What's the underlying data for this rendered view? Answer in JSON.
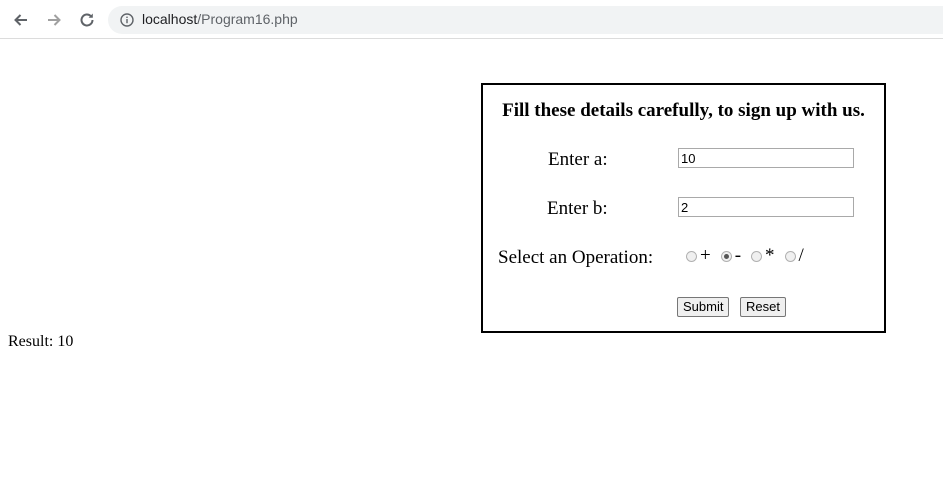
{
  "browser": {
    "url_host": "localhost",
    "url_path": "/Program16.php"
  },
  "form": {
    "title": "Fill these details carefully, to sign up with us.",
    "field_a": {
      "label": "Enter a:",
      "value": "10"
    },
    "field_b": {
      "label": "Enter b:",
      "value": "2"
    },
    "operation": {
      "label": "Select an Operation:",
      "options": [
        {
          "label": "+",
          "checked": false
        },
        {
          "label": "-",
          "checked": true
        },
        {
          "label": "*",
          "checked": false
        },
        {
          "label": "/",
          "checked": false
        }
      ]
    },
    "submit_label": "Submit",
    "reset_label": "Reset"
  },
  "result": {
    "text": "Result: 10"
  }
}
